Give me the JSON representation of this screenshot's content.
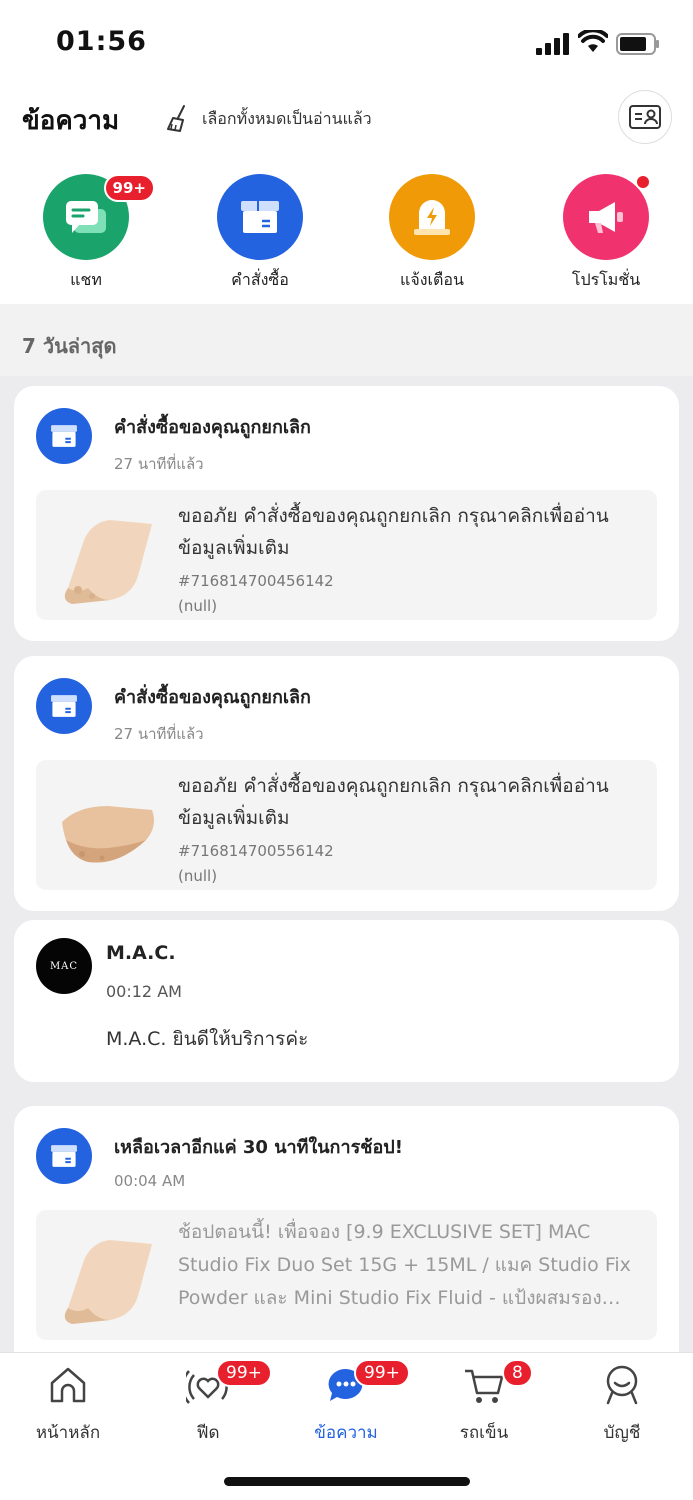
{
  "status_bar": {
    "time": "01:56"
  },
  "header": {
    "title": "ข้อความ",
    "mark_all_read": "เลือกทั้งหมดเป็นอ่านแล้ว"
  },
  "categories": [
    {
      "label": "แชท",
      "badge": "99+",
      "color": "#1aa36b",
      "icon": "chat-icon"
    },
    {
      "label": "คำสั่งซื้อ",
      "color": "#2463e0",
      "icon": "box-icon"
    },
    {
      "label": "แจ้งเตือน",
      "color": "#f09a07",
      "icon": "alert-icon"
    },
    {
      "label": "โปรโมชั่น",
      "color": "#f0336f",
      "icon": "megaphone-icon",
      "dot": true
    }
  ],
  "section": {
    "title": "7 วันล่าสุด"
  },
  "messages": [
    {
      "title": "คำสั่งซื้อของคุณถูกยกเลิก",
      "time": "27 นาทีที่แล้ว",
      "body_line1": "ขออภัย คำสั่งซื้อของคุณถูกยกเลิก กรุณาคลิกเพื่ออ่าน",
      "body_line2": "ข้อมูลเพิ่มเติม",
      "order": "#716814700456142",
      "extra": "(null)"
    },
    {
      "title": "คำสั่งซื้อของคุณถูกยกเลิก",
      "time": "27 นาทีที่แล้ว",
      "body_line1": "ขออภัย คำสั่งซื้อของคุณถูกยกเลิก กรุณาคลิกเพื่ออ่าน",
      "body_line2": "ข้อมูลเพิ่มเติม",
      "order": "#716814700556142",
      "extra": "(null)"
    },
    {
      "sender": "M.A.C.",
      "logo_text": "MAC",
      "time": "00:12 AM",
      "text": "M.A.C. ยินดีให้บริการค่ะ"
    },
    {
      "title": "เหลือเวลาอีกแค่ 30 นาทีในการช้อป!",
      "time": "00:04 AM",
      "body_line1": "ช้อปตอนนี้! เพื่อจอง [9.9 EXCLUSIVE SET] MAC",
      "body_line2": "Studio Fix Duo Set 15G + 15ML / แมค Studio Fix",
      "body_line3": "Powder และ Mini Studio Fix Fluid - แป้งผสมรอง…"
    }
  ],
  "bottom_nav": [
    {
      "label": "หน้าหลัก",
      "icon": "home-icon"
    },
    {
      "label": "ฟีด",
      "icon": "feed-icon",
      "badge": "99+"
    },
    {
      "label": "ข้อความ",
      "icon": "message-icon",
      "badge": "99+",
      "active": true
    },
    {
      "label": "รถเข็น",
      "icon": "cart-icon",
      "badge": "8"
    },
    {
      "label": "บัญชี",
      "icon": "account-icon"
    }
  ],
  "colors": {
    "primary": "#2463e0",
    "badge": "#e8202d"
  }
}
